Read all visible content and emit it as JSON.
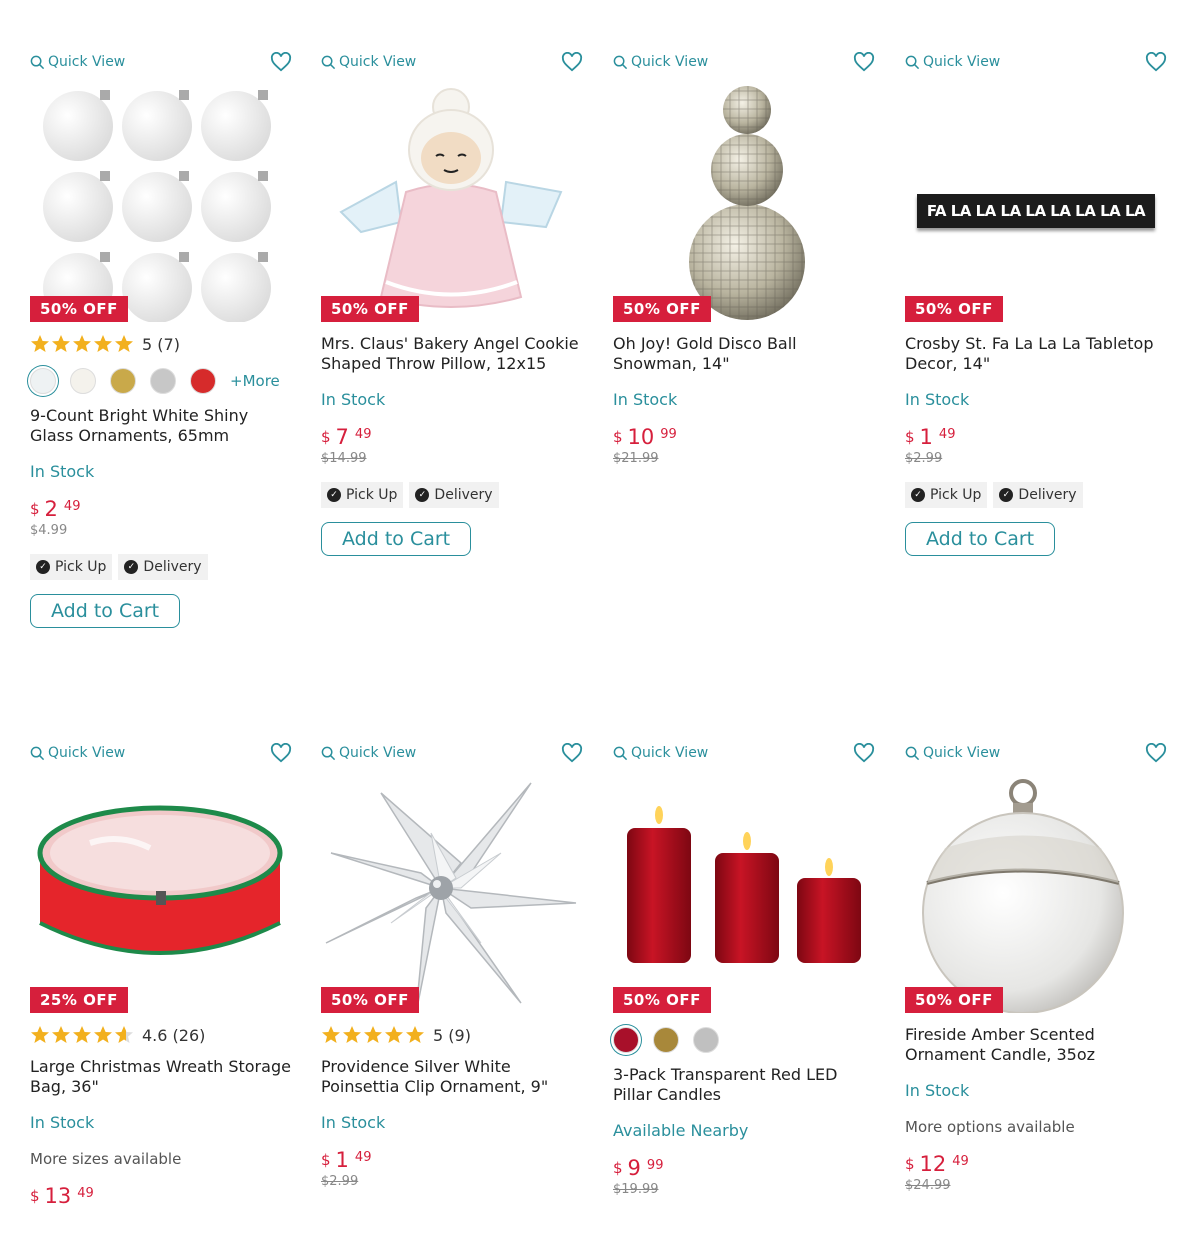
{
  "common": {
    "quick_view": "Quick View",
    "add_to_cart": "Add to Cart",
    "pick_up": "Pick Up",
    "delivery": "Delivery",
    "currency": "$"
  },
  "colors": {
    "accent": "#2a8f9c",
    "sale": "#d61f3c",
    "star": "#f2b01e"
  },
  "products": [
    {
      "badge": "50% OFF",
      "rating_count": "5 (7)",
      "stars": 5,
      "swatches": [
        "#eef2f3",
        "#f4f2ec",
        "#c9a94a",
        "#c7c7c7",
        "#d62b2b"
      ],
      "swatch_more": "+More",
      "title": "9-Count Bright White Shiny Glass Ornaments, 65mm",
      "stock": "In Stock",
      "price_dollars": "2",
      "price_cents": "49",
      "old_price": "$4.99",
      "icon": "ornaments-image"
    },
    {
      "badge": "50% OFF",
      "title": "Mrs. Claus' Bakery Angel Cookie Shaped Throw Pillow, 12x15",
      "stock": "In Stock",
      "price_dollars": "7",
      "price_cents": "49",
      "old_price": "$14.99",
      "icon": "angel-pillow-image"
    },
    {
      "badge": "50% OFF",
      "title": "Oh Joy! Gold Disco Ball Snowman, 14\"",
      "stock": "In Stock",
      "price_dollars": "10",
      "price_cents": "99",
      "old_price": "$21.99",
      "icon": "disco-snowman-image"
    },
    {
      "badge": "50% OFF",
      "title": "Crosby St. Fa La La La Tabletop Decor, 14\"",
      "stock": "In Stock",
      "price_dollars": "1",
      "price_cents": "49",
      "old_price": "$2.99",
      "sign_text": "FA LA LA LA LA LA LA LA LA",
      "icon": "falala-sign-image"
    },
    {
      "badge": "25% OFF",
      "rating_count": "4.6 (26)",
      "stars": 4.6,
      "title": "Large Christmas Wreath Storage Bag, 36\"",
      "stock": "In Stock",
      "more_options": "More sizes available",
      "price_dollars": "13",
      "price_cents": "49",
      "icon": "wreath-bag-image"
    },
    {
      "badge": "50% OFF",
      "rating_count": "5 (9)",
      "stars": 5,
      "title": "Providence Silver White Poinsettia Clip Ornament, 9\"",
      "stock": "In Stock",
      "price_dollars": "1",
      "price_cents": "49",
      "old_price": "$2.99",
      "icon": "poinsettia-image"
    },
    {
      "badge": "50% OFF",
      "swatches": [
        "#a8102a",
        "#a8883a",
        "#c0c0c0"
      ],
      "title": "3-Pack Transparent Red LED Pillar Candles",
      "stock": "Available Nearby",
      "price_dollars": "9",
      "price_cents": "99",
      "old_price": "$19.99",
      "icon": "led-candles-image"
    },
    {
      "badge": "50% OFF",
      "title": "Fireside Amber Scented Ornament Candle, 35oz",
      "stock": "In Stock",
      "more_options": "More options available",
      "price_dollars": "12",
      "price_cents": "49",
      "old_price": "$24.99",
      "icon": "ornament-candle-image"
    }
  ]
}
